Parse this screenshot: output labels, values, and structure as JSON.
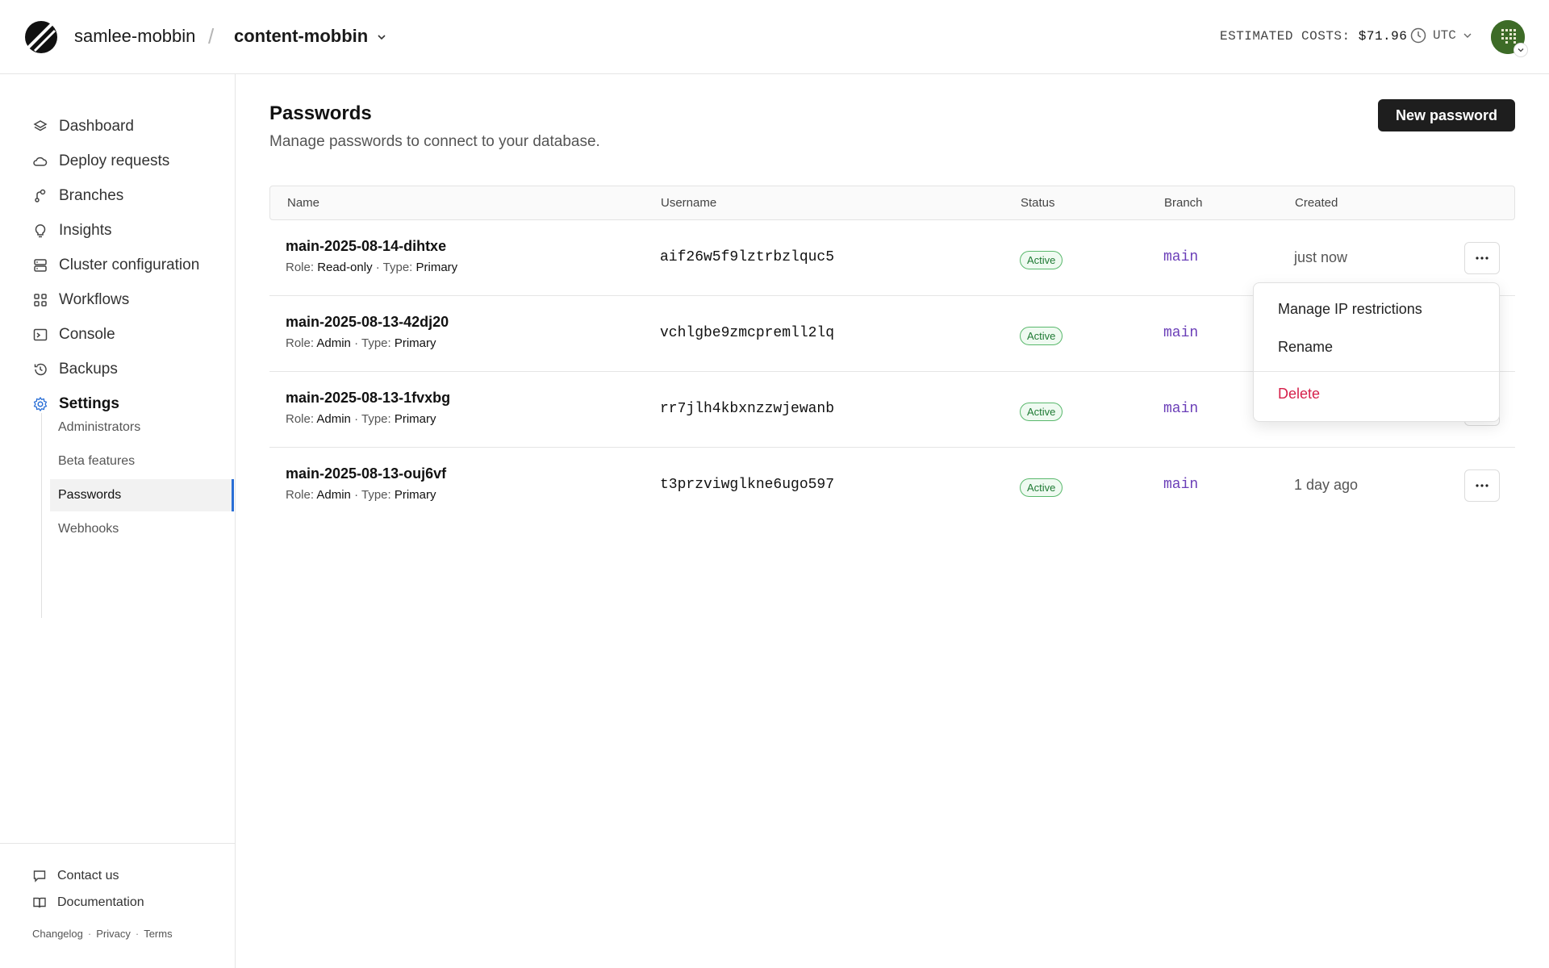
{
  "header": {
    "org": "samlee-mobbin",
    "separator": "/",
    "database": "content-mobbin",
    "costs_label": "ESTIMATED COSTS:",
    "costs_value": "$71.96",
    "timezone": "UTC"
  },
  "sidebar": {
    "items": [
      {
        "label": "Dashboard",
        "icon": "layers-icon"
      },
      {
        "label": "Deploy requests",
        "icon": "cloud-icon"
      },
      {
        "label": "Branches",
        "icon": "branch-icon"
      },
      {
        "label": "Insights",
        "icon": "lightbulb-icon"
      },
      {
        "label": "Cluster configuration",
        "icon": "server-icon"
      },
      {
        "label": "Workflows",
        "icon": "workflow-icon"
      },
      {
        "label": "Console",
        "icon": "terminal-icon"
      },
      {
        "label": "Backups",
        "icon": "history-icon"
      },
      {
        "label": "Settings",
        "icon": "gear-icon"
      }
    ],
    "settings_sub": [
      "Administrators",
      "Beta features",
      "Passwords",
      "Webhooks"
    ],
    "footer": {
      "contact": "Contact us",
      "docs": "Documentation",
      "changelog": "Changelog",
      "privacy": "Privacy",
      "terms": "Terms",
      "dot": "·"
    }
  },
  "main": {
    "title": "Passwords",
    "subtitle": "Manage passwords to connect to your database.",
    "new_button": "New password",
    "columns": [
      "Name",
      "Username",
      "Status",
      "Branch",
      "Created"
    ],
    "role_label": "Role:",
    "type_label": "Type:",
    "meta_sep": "·",
    "rows": [
      {
        "name": "main-2025-08-14-dihtxe",
        "role": "Read-only",
        "type": "Primary",
        "username": "aif26w5f9lztrbzlquc5",
        "status": "Active",
        "branch": "main",
        "created": "just now"
      },
      {
        "name": "main-2025-08-13-42dj20",
        "role": "Admin",
        "type": "Primary",
        "username": "vchlgbe9zmcpremll2lq",
        "status": "Active",
        "branch": "main",
        "created": ""
      },
      {
        "name": "main-2025-08-13-1fvxbg",
        "role": "Admin",
        "type": "Primary",
        "username": "rr7jlh4kbxnzzwjewanb",
        "status": "Active",
        "branch": "main",
        "created": ""
      },
      {
        "name": "main-2025-08-13-ouj6vf",
        "role": "Admin",
        "type": "Primary",
        "username": "t3przviwglkne6ugo597",
        "status": "Active",
        "branch": "main",
        "created": "1 day ago"
      }
    ]
  },
  "dropdown": {
    "items": [
      "Manage IP restrictions",
      "Rename",
      "Delete"
    ]
  }
}
